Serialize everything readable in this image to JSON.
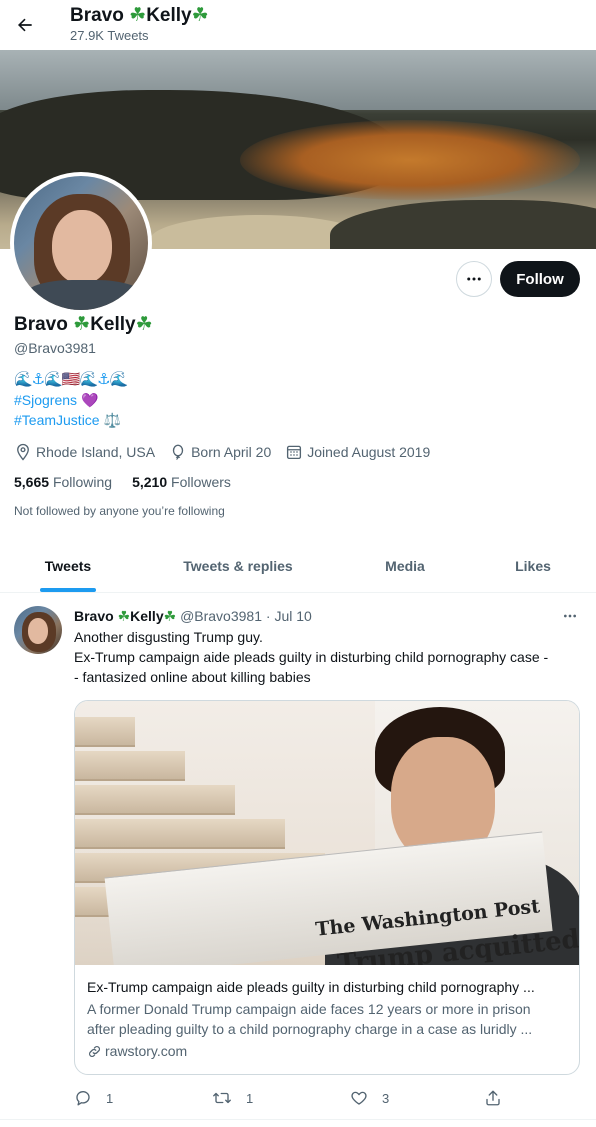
{
  "header": {
    "name_text": "Bravo",
    "name_text2": "Kelly",
    "tweets_count": "27.9K Tweets"
  },
  "profile": {
    "display_name_1": "Bravo",
    "display_name_2": "Kelly",
    "handle": "@Bravo3981",
    "bio_emoji_row": "🌊⚓🌊🇺🇸🌊⚓🌊",
    "bio_line2_tag": "#Sjogrens",
    "bio_line2_emoji": "💜",
    "bio_line3_tag": "#TeamJustice",
    "bio_line3_emoji": "⚖️",
    "location": "Rhode Island, USA",
    "born": "Born April 20",
    "joined": "Joined August 2019",
    "following_count": "5,665",
    "following_label": "Following",
    "followers_count": "5,210",
    "followers_label": "Followers",
    "not_followed_note": "Not followed by anyone you’re following",
    "follow_label": "Follow"
  },
  "tabs": [
    {
      "label": "Tweets",
      "active": true
    },
    {
      "label": "Tweets & replies",
      "active": false
    },
    {
      "label": "Media",
      "active": false
    },
    {
      "label": "Likes",
      "active": false
    }
  ],
  "tweet": {
    "name_1": "Bravo",
    "name_2": "Kelly",
    "handle": "@Bravo3981",
    "sep": "·",
    "date": "Jul 10",
    "text_line1": "Another disgusting Trump guy.",
    "text_line2": "Ex-Trump campaign aide pleads guilty in disturbing child pornography case -",
    "text_line3": "- fantasized online about killing babies",
    "card": {
      "newspaper_masthead": "The Washington Post",
      "newspaper_headline": "Trump acquitted",
      "title": "Ex-Trump campaign aide pleads guilty in disturbing child pornography ...",
      "desc_line1": "A former Donald Trump campaign aide faces 12 years or more in prison",
      "desc_line2": "after pleading guilty to a child pornography charge in a case as luridly ...",
      "domain": "rawstory.com"
    },
    "replies": "1",
    "retweets": "1",
    "likes": "3"
  },
  "colors": {
    "accent": "#1d9bf0",
    "text": "#0f1419",
    "secondary": "#536471",
    "clover": "#2e9a3b"
  },
  "icons": [
    "back-arrow-icon",
    "shamrock-icon",
    "more-icon",
    "location-pin-icon",
    "balloon-icon",
    "calendar-icon",
    "link-icon",
    "reply-icon",
    "retweet-icon",
    "like-icon",
    "share-icon"
  ]
}
